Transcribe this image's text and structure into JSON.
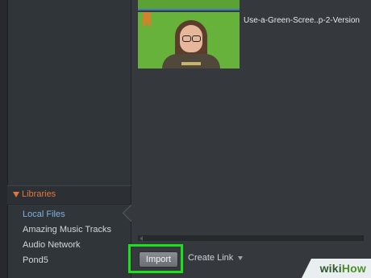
{
  "sidebar": {
    "libraries_label": "Libraries",
    "items": [
      {
        "label": "Local Files"
      },
      {
        "label": "Amazing Music Tracks"
      },
      {
        "label": "Audio Network"
      },
      {
        "label": "Pond5"
      }
    ]
  },
  "media": {
    "file_name": "Use-a-Green-Scree..p-2-Version"
  },
  "toolbar": {
    "import_label": "Import",
    "create_link_label": "Create Link"
  },
  "watermark": {
    "wiki": "wiki",
    "how": "How"
  },
  "colors": {
    "accent_orange": "#e0783c",
    "active_blue": "#7fb3dc",
    "highlight_green": "#19e21b",
    "green_screen": "#67b23a"
  }
}
